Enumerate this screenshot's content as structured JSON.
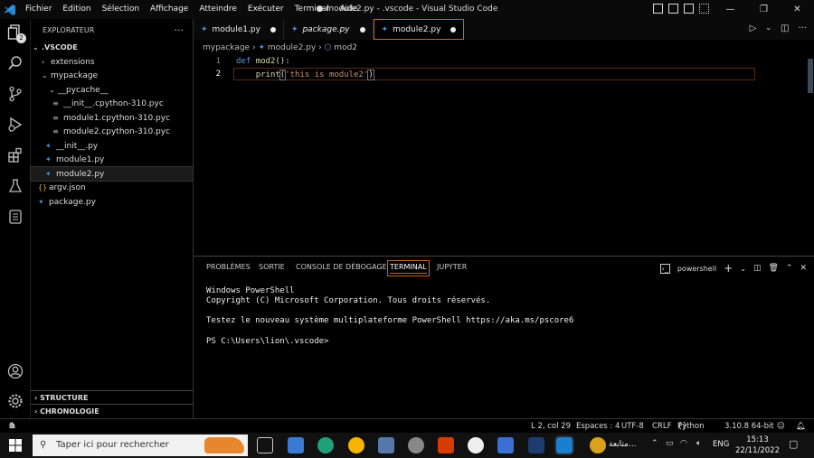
{
  "titlebar": {
    "menu": [
      "Fichier",
      "Edition",
      "Sélection",
      "Affichage",
      "Atteindre",
      "Exécuter",
      "Terminal",
      "Aide"
    ],
    "title": "● module2.py - .vscode - Visual Studio Code"
  },
  "activity": {
    "badge": "2"
  },
  "sidebar": {
    "header": "EXPLORATEUR",
    "root": ".VSCODE",
    "items": [
      {
        "label": "extensions"
      },
      {
        "label": "mypackage"
      },
      {
        "label": "__pycache__"
      },
      {
        "label": "__init__.cpython-310.pyc"
      },
      {
        "label": "module1.cpython-310.pyc"
      },
      {
        "label": "module2.cpython-310.pyc"
      },
      {
        "label": "__init__.py"
      },
      {
        "label": "module1.py"
      },
      {
        "label": "module2.py"
      },
      {
        "label": "argv.json"
      },
      {
        "label": "package.py"
      }
    ],
    "sections": [
      "STRUCTURE",
      "CHRONOLOGIE"
    ]
  },
  "tabs": [
    {
      "label": "module1.py"
    },
    {
      "label": "package.py"
    },
    {
      "label": "module2.py"
    }
  ],
  "breadcrumb": {
    "folder": "mypackage",
    "file": "module2.py",
    "symbol": "mod2"
  },
  "editor": {
    "line_numbers": [
      "1",
      "2"
    ],
    "line1": {
      "kw": "def",
      "name": "mod2",
      "rest": "():"
    },
    "line2": {
      "indent": "    ",
      "fn": "print",
      "open": "(",
      "str": "'this is module2'",
      "close": ")"
    }
  },
  "panel": {
    "tabs": [
      "PROBLÈMES",
      "SORTIE",
      "CONSOLE DE DÉBOGAGE",
      "TERMINAL",
      "JUPYTER"
    ],
    "shell": "powershell",
    "terminal_lines": [
      "Windows PowerShell",
      "Copyright (C) Microsoft Corporation. Tous droits réservés.",
      "",
      "Testez le nouveau système multiplateforme PowerShell https://aka.ms/pscore6",
      "",
      "PS C:\\Users\\lion\\.vscode>"
    ]
  },
  "status": {
    "errors": "0",
    "warnings": "0",
    "position": "L 2, col 29",
    "spaces": "Espaces : 4",
    "encoding": "UTF-8",
    "eol": "CRLF",
    "language": "Python",
    "interpreter": "3.10.8 64-bit"
  },
  "taskbar": {
    "search_placeholder": "Taper ici pour rechercher",
    "weather_label": "متابعة...",
    "lang": "ENG",
    "time": "15:13",
    "date": "22/11/2022"
  },
  "colors": {
    "accent": "#c06a20",
    "python_blue": "#4a90d9",
    "keyword": "#569cd6",
    "string": "#ce9178",
    "function": "#dcdcaa"
  }
}
